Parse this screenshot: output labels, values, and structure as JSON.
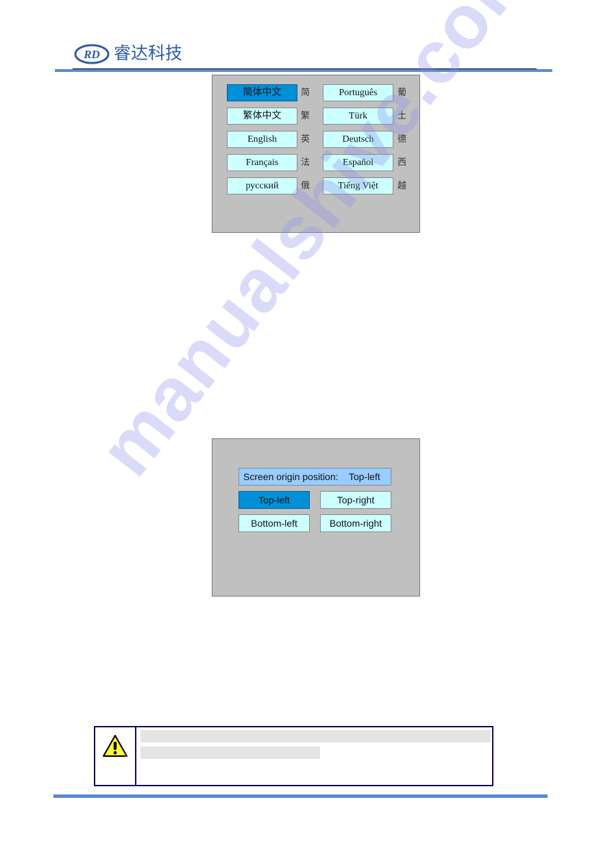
{
  "header": {
    "logo_mark": "RD",
    "company_name": "睿达科技",
    "brand_color": "#2f5aa6",
    "rule_color": "#5a8ad0"
  },
  "language_panel": {
    "selected": "简体中文",
    "items": [
      {
        "label": "简体中文",
        "abbr": "简",
        "selected": true
      },
      {
        "label": "繁体中文",
        "abbr": "繁",
        "selected": false
      },
      {
        "label": "English",
        "abbr": "英",
        "selected": false
      },
      {
        "label": "Français",
        "abbr": "法",
        "selected": false
      },
      {
        "label": "русский",
        "abbr": "俄",
        "selected": false
      },
      {
        "label": "Português",
        "abbr": "葡",
        "selected": false
      },
      {
        "label": "Türk",
        "abbr": "土",
        "selected": false
      },
      {
        "label": "Deutsch",
        "abbr": "德",
        "selected": false
      },
      {
        "label": "Español",
        "abbr": "西",
        "selected": false
      },
      {
        "label": "Tiếng Việt",
        "abbr": "越",
        "selected": false
      }
    ]
  },
  "origin_panel": {
    "label": "Screen origin position:    Top-left",
    "options": [
      {
        "label": "Top-left",
        "selected": true
      },
      {
        "label": "Top-right",
        "selected": false
      },
      {
        "label": "Bottom-left",
        "selected": false
      },
      {
        "label": "Bottom-right",
        "selected": false
      }
    ]
  },
  "watermark": "manualshive.com",
  "warning": {
    "icon": "warning-triangle-icon"
  },
  "colors": {
    "panel_bg": "#c0c0c0",
    "button_bg": "#ccffff",
    "selected_bg": "#0090d8",
    "label_bg": "#99ccff",
    "warning_border": "#0a0a5a"
  }
}
